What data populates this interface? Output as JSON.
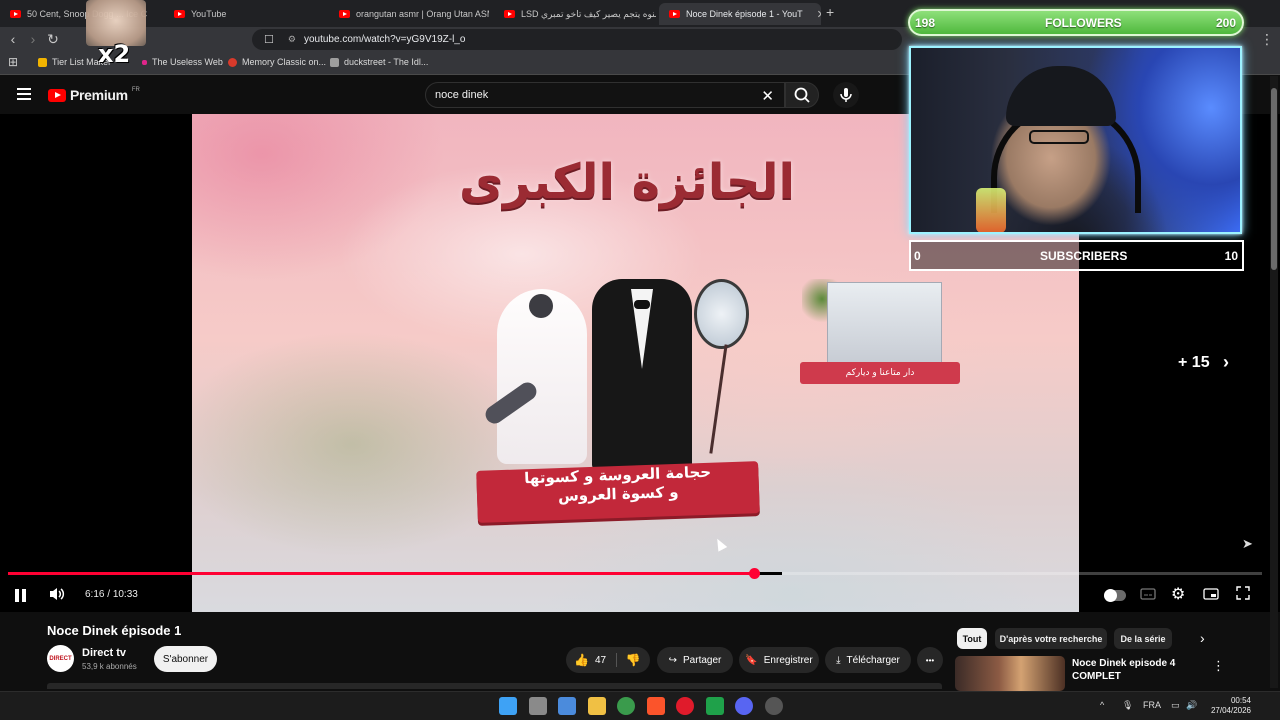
{
  "browser": {
    "tabs": [
      {
        "title": "50 Cent, Snoop Dogg ... Ice C",
        "active": false
      },
      {
        "title": "YouTube",
        "active": false
      },
      {
        "title": "orangutan asmr | Orang Utan ASMR",
        "active": false
      },
      {
        "title": "LSD شنوه يتجم يصير كيف تاخو تمبري",
        "active": false
      },
      {
        "title": "Noce Dinek épisode 1 - YouT",
        "active": true
      }
    ],
    "new_tab": "+",
    "url": "youtube.com/watch?v=yG9V19Z-l_o",
    "bookmarks": [
      {
        "label": "Tier List Maker",
        "color": "#f2b400"
      },
      {
        "label": "The Useless Web",
        "color": "#e0258a"
      },
      {
        "label": "Memory Classic on...",
        "color": "#d83a2b"
      },
      {
        "label": "duckstreet - The Idl...",
        "color": "#9e9e9e"
      }
    ]
  },
  "youtube": {
    "logo_text": "Premium",
    "logo_region": "FR",
    "search_value": "noce dinek",
    "video": {
      "thumbnail_title_ar": "الجائزة الكبرى",
      "banner_line1": "حجامة العروسة و كسوتها",
      "banner_line2": "و كسوة العروس",
      "house_tag": "دار متاعنا و دياركم",
      "skip_label": "+ 15",
      "current_time": "6:16",
      "duration": "10:33",
      "progress_fraction": 0.595,
      "buffer_gap_fraction": [
        0.598,
        0.617
      ]
    },
    "details": {
      "title": "Noce Dinek épisode 1",
      "channel_name": "Direct tv",
      "avatar_text": "DIRECT",
      "subscribers": "53,9 k abonnés",
      "subscribe_label": "S'abonner",
      "likes": "47",
      "share_label": "Partager",
      "save_label": "Enregistrer",
      "download_label": "Télécharger",
      "more_label": "•••"
    },
    "chips": [
      "Tout",
      "D'après votre recherche",
      "De la série"
    ],
    "recommendation": {
      "title": "Noce Dinek episode 4 COMPLET"
    }
  },
  "overlay": {
    "followers_current": "198",
    "followers_label": "FOLLOWERS",
    "followers_goal": "200",
    "subscribers_current": "0",
    "subscribers_label": "SUBSCRIBERS",
    "subscribers_goal": "10",
    "multiplier": "x2"
  },
  "taskbar": {
    "language": "FRA",
    "time": "00:54",
    "date": "27/04/2026",
    "apps": [
      {
        "name": "windows-start",
        "color": "#3ea2f5"
      },
      {
        "name": "task-view",
        "color": "#8a8a8a"
      },
      {
        "name": "store",
        "color": "#4b8bdc"
      },
      {
        "name": "file-explorer",
        "color": "#f0c044"
      },
      {
        "name": "chrome",
        "color": "#3a9b4c"
      },
      {
        "name": "brave",
        "color": "#fb542b"
      },
      {
        "name": "opera",
        "color": "#e01b2b"
      },
      {
        "name": "xbox",
        "color": "#1fa14a"
      },
      {
        "name": "discord",
        "color": "#5865f2"
      },
      {
        "name": "obs",
        "color": "#555555"
      }
    ]
  },
  "colors": {
    "accent_red": "#ff0033",
    "followers_green": "#4fb83d",
    "webcam_glow": "#7cd9ff"
  }
}
